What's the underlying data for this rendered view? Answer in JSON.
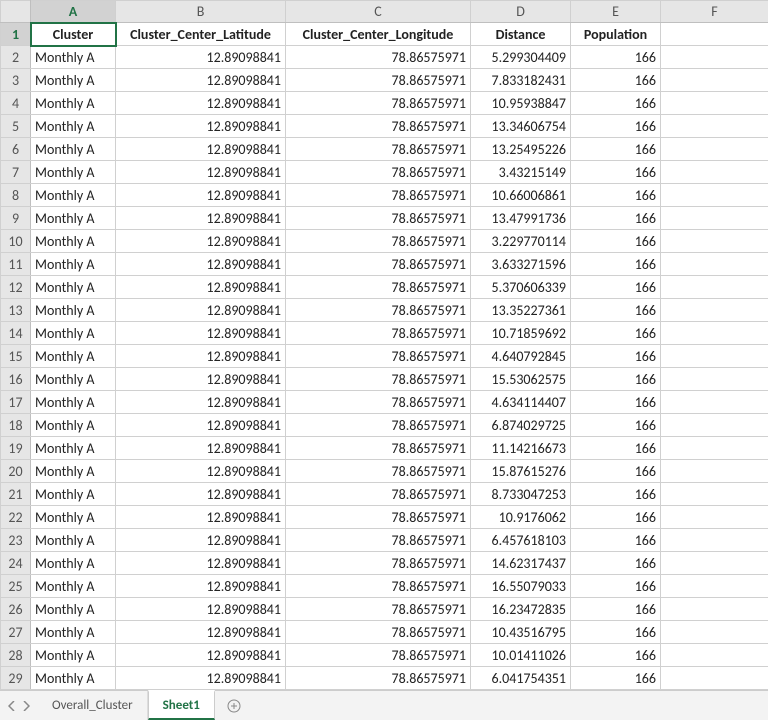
{
  "columns": [
    "A",
    "B",
    "C",
    "D",
    "E",
    "F"
  ],
  "header_row": [
    "Cluster",
    "Cluster_Center_Latitude",
    "Cluster_Center_Longitude",
    "Distance",
    "Population",
    ""
  ],
  "rows": [
    [
      "Monthly A",
      "12.89098841",
      "78.86575971",
      "5.299304409",
      "166",
      ""
    ],
    [
      "Monthly A",
      "12.89098841",
      "78.86575971",
      "7.833182431",
      "166",
      ""
    ],
    [
      "Monthly A",
      "12.89098841",
      "78.86575971",
      "10.95938847",
      "166",
      ""
    ],
    [
      "Monthly A",
      "12.89098841",
      "78.86575971",
      "13.34606754",
      "166",
      ""
    ],
    [
      "Monthly A",
      "12.89098841",
      "78.86575971",
      "13.25495226",
      "166",
      ""
    ],
    [
      "Monthly A",
      "12.89098841",
      "78.86575971",
      "3.43215149",
      "166",
      ""
    ],
    [
      "Monthly A",
      "12.89098841",
      "78.86575971",
      "10.66006861",
      "166",
      ""
    ],
    [
      "Monthly A",
      "12.89098841",
      "78.86575971",
      "13.47991736",
      "166",
      ""
    ],
    [
      "Monthly A",
      "12.89098841",
      "78.86575971",
      "3.229770114",
      "166",
      ""
    ],
    [
      "Monthly A",
      "12.89098841",
      "78.86575971",
      "3.633271596",
      "166",
      ""
    ],
    [
      "Monthly A",
      "12.89098841",
      "78.86575971",
      "5.370606339",
      "166",
      ""
    ],
    [
      "Monthly A",
      "12.89098841",
      "78.86575971",
      "13.35227361",
      "166",
      ""
    ],
    [
      "Monthly A",
      "12.89098841",
      "78.86575971",
      "10.71859692",
      "166",
      ""
    ],
    [
      "Monthly A",
      "12.89098841",
      "78.86575971",
      "4.640792845",
      "166",
      ""
    ],
    [
      "Monthly A",
      "12.89098841",
      "78.86575971",
      "15.53062575",
      "166",
      ""
    ],
    [
      "Monthly A",
      "12.89098841",
      "78.86575971",
      "4.634114407",
      "166",
      ""
    ],
    [
      "Monthly A",
      "12.89098841",
      "78.86575971",
      "6.874029725",
      "166",
      ""
    ],
    [
      "Monthly A",
      "12.89098841",
      "78.86575971",
      "11.14216673",
      "166",
      ""
    ],
    [
      "Monthly A",
      "12.89098841",
      "78.86575971",
      "15.87615276",
      "166",
      ""
    ],
    [
      "Monthly A",
      "12.89098841",
      "78.86575971",
      "8.733047253",
      "166",
      ""
    ],
    [
      "Monthly A",
      "12.89098841",
      "78.86575971",
      "10.9176062",
      "166",
      ""
    ],
    [
      "Monthly A",
      "12.89098841",
      "78.86575971",
      "6.457618103",
      "166",
      ""
    ],
    [
      "Monthly A",
      "12.89098841",
      "78.86575971",
      "14.62317437",
      "166",
      ""
    ],
    [
      "Monthly A",
      "12.89098841",
      "78.86575971",
      "16.55079033",
      "166",
      ""
    ],
    [
      "Monthly A",
      "12.89098841",
      "78.86575971",
      "16.23472835",
      "166",
      ""
    ],
    [
      "Monthly A",
      "12.89098841",
      "78.86575971",
      "10.43516795",
      "166",
      ""
    ],
    [
      "Monthly A",
      "12.89098841",
      "78.86575971",
      "10.01411026",
      "166",
      ""
    ],
    [
      "Monthly A",
      "12.89098841",
      "78.86575971",
      "6.041754351",
      "166",
      ""
    ]
  ],
  "tabs": {
    "inactive": "Overall_Cluster",
    "active": "Sheet1"
  }
}
